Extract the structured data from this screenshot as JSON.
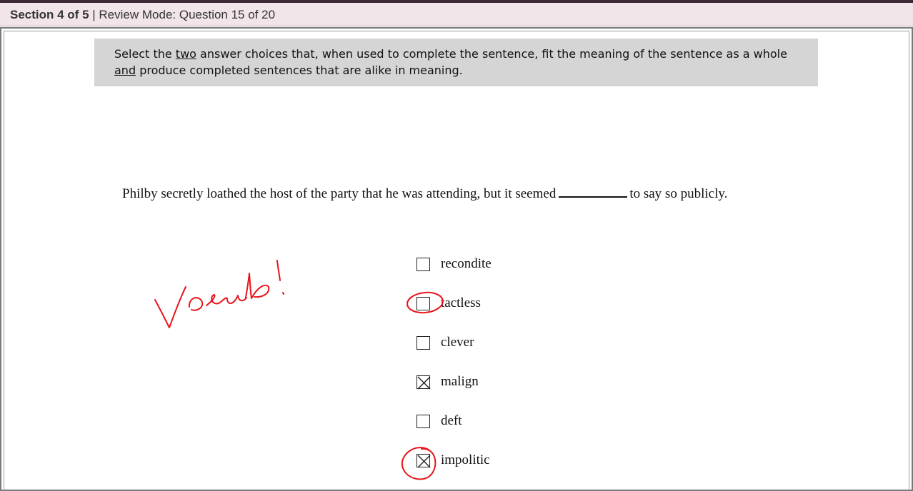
{
  "status": {
    "section": "Section 4 of 5",
    "separator": " | ",
    "mode": "Review Mode: Question 15 of 20"
  },
  "instructions": {
    "part1": "Select the ",
    "two": "two",
    "part2": " answer choices that, when used to complete the sentence, fit the meaning of the sentence as a whole ",
    "and": "and",
    "part3": " produce completed sentences that are alike in meaning."
  },
  "question": {
    "before_blank": "Philby secretly loathed the host of the party that he was attending, but it seemed",
    "after_blank": "to say so publicly."
  },
  "choices": [
    {
      "label": "recondite",
      "checked": false
    },
    {
      "label": "tactless",
      "checked": false
    },
    {
      "label": "clever",
      "checked": false
    },
    {
      "label": "malign",
      "checked": true
    },
    {
      "label": "deft",
      "checked": false
    },
    {
      "label": "impolitic",
      "checked": true
    }
  ],
  "annotation": {
    "color": "#e8141b",
    "handwritten_note": "Vocab!"
  }
}
